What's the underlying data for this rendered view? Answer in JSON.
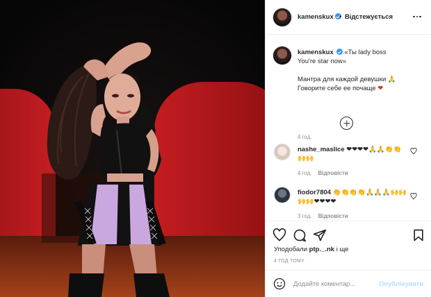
{
  "header": {
    "username": "kamenskux",
    "dot": "•",
    "follow_label": "Відстежується",
    "more_icon": "more-options-icon"
  },
  "caption": {
    "username": "kamenskux",
    "lines": [
      "«Ты lady boss",
      "You're star now»",
      "Мантра для каждой девушки 🙏",
      "Говорите себе ее почаще"
    ],
    "heart": "❤",
    "time": "4 год."
  },
  "comments": [
    {
      "username": "nashe_maslice",
      "text": "❤❤❤❤🙏🙏👏👏🙌🙌",
      "time": "4 год.",
      "reply_label": "Відповісти"
    },
    {
      "username": "fiodor7804",
      "text": "👏👏👏👏🙏🙏🙏🙌🙌🙌🙌❤❤❤❤",
      "time": "3 год.",
      "reply_label": "Відповісти"
    }
  ],
  "likes": {
    "prefix": "Уподобали ",
    "users": "ptp._.nk",
    "suffix": " і ще"
  },
  "posted_ago": "4 ГОД ТОМУ",
  "add_comment": {
    "placeholder": "Додайте коментар...",
    "publish_label": "Опублікувати"
  },
  "colors": {
    "accent": "#3897f0",
    "publish_disabled": "#b2dffc",
    "heart_red": "#c0392b",
    "photo_red": "#b3191c",
    "skirt_lilac": "#c9a8e0"
  }
}
